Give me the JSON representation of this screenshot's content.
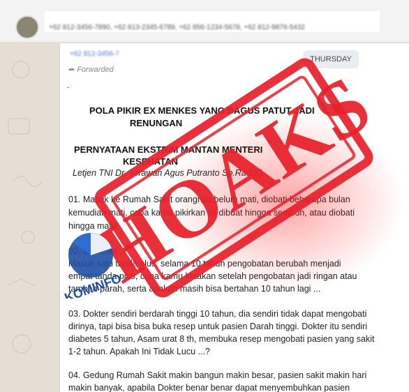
{
  "header": {
    "numbers": "+62 812-3456-7890, +62 813-2345-6789, +62 856-1234-5678, +62 812-9876-5432"
  },
  "message": {
    "sender": "+62 812-3456-7890",
    "forwarded_label": "Forwarded",
    "day_badge": "THURSDAY",
    "dot": ".",
    "title_line1": "POLA PIKIR EX MENKES YANG BAGUS PATUT JADI",
    "title_line2": "RENUNGAN",
    "subtitle_line1": "PERNYATAAN EKSTRIM MANTAN MENTERI",
    "subtitle_line2": "KESEHATAN",
    "author": "Letjen TNI Dr. Terawan Agus Putranto Sp.Rad(K)",
    "p1_l1": "01. Masuk ke Rumah Sakit orangnya belum mati, diobati beberapa bulan",
    "p1_l2": "kemudian mati, coba kamu pikirkan ini dibuat hingga sembuh, atau diobati",
    "p1_l3": "hingga mati?",
    "p2_l1": "02. Diabetes ...",
    "p2_l2": "Masuk satu tanda plus, selama 10 tahun pengobatan berubah menjadi",
    "p2_l3": "empat tanda plus, coba kamu katakan setelah pengobatan jadi ringan atau",
    "p2_l4": "tambah parah, serta apakah masih bisa bertahan 10 tahun lagi ...",
    "p3_l1": "03. Dokter sendiri berdarah tinggi 10 tahun, dia sendiri tidak dapat mengobati",
    "p3_l2": "dirinya, tapi bisa bisa buka resep untuk pasien Darah tinggi. Dokter itu sendiri",
    "p3_l3": "diabetes 5 tahun, Asam urat 8 th, membuka resep mengobati pasien yang sakit",
    "p3_l4": "1-2 tahun. Apakah Ini Tidak Lucu ...?",
    "p4_l1": "04. Gedung Rumah Sakit makin bangun makin besar, pasien sakit makin hari",
    "p4_l2": "makin banyak, apabila Dokter benar benar dapat menyembuhkan pasien"
  },
  "stamp": {
    "text": "HOAKS",
    "color": "#e8202a"
  },
  "logo": {
    "text": "KOMINFO",
    "color": "#1f4fa3"
  }
}
